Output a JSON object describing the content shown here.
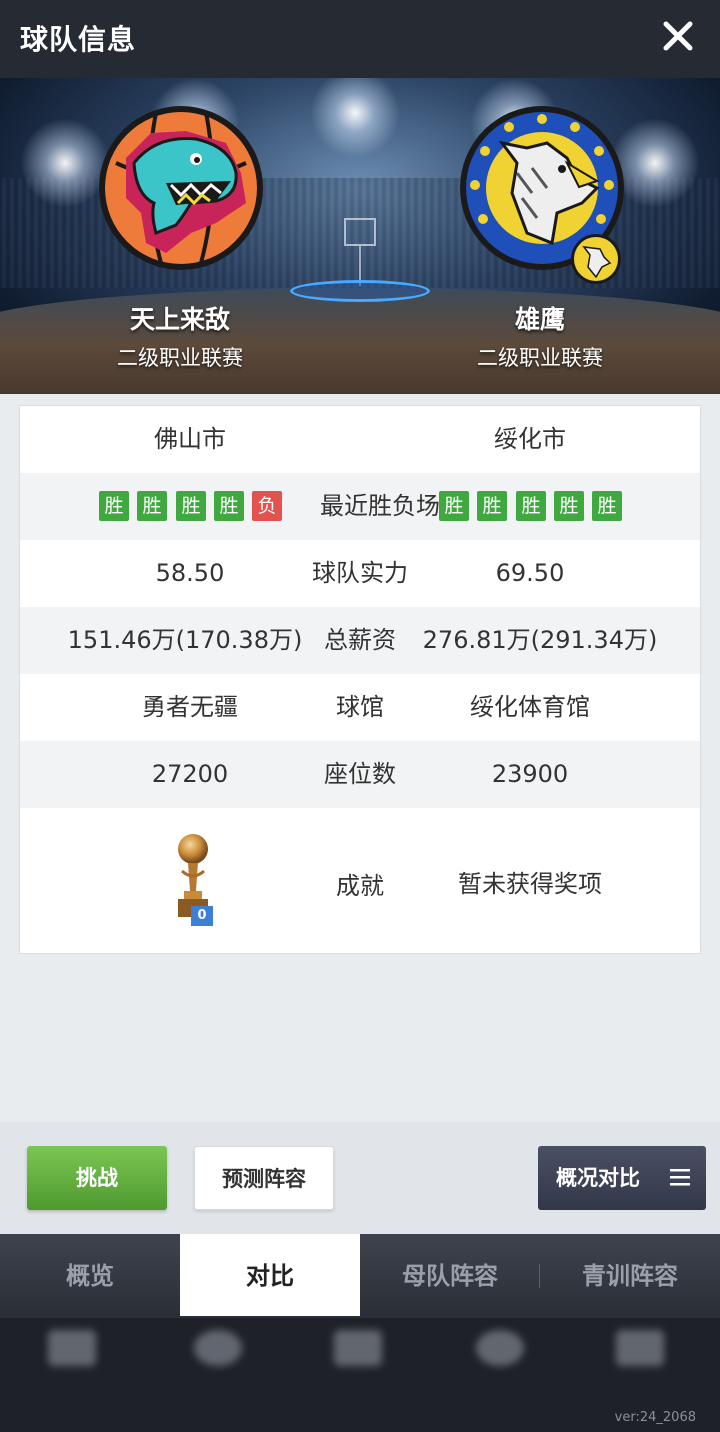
{
  "header": {
    "title": "球队信息"
  },
  "teams": {
    "home": {
      "name": "天上来敌",
      "league": "二级职业联赛",
      "city": "佛山市"
    },
    "away": {
      "name": "雄鹰",
      "league": "二级职业联赛",
      "city": "绥化市"
    }
  },
  "recent": {
    "label": "最近胜负场",
    "home": [
      "胜",
      "胜",
      "胜",
      "胜",
      "负"
    ],
    "away": [
      "胜",
      "胜",
      "胜",
      "胜",
      "胜"
    ]
  },
  "stats": {
    "strength": {
      "label": "球队实力",
      "home": "58.50",
      "away": "69.50"
    },
    "salary": {
      "label": "总薪资",
      "home": "151.46万(170.38万)",
      "away": "276.81万(291.34万)"
    },
    "arena": {
      "label": "球馆",
      "home": "勇者无疆",
      "away": "绥化体育馆"
    },
    "seats": {
      "label": "座位数",
      "home": "27200",
      "away": "23900"
    },
    "achievement": {
      "label": "成就",
      "home_count": "0",
      "away": "暂未获得奖项"
    }
  },
  "actions": {
    "challenge": "挑战",
    "predict": "预测阵容",
    "overview": "概况对比"
  },
  "tabs": [
    {
      "label": "概览",
      "active": false
    },
    {
      "label": "对比",
      "active": true
    },
    {
      "label": "母队阵容",
      "active": false
    },
    {
      "label": "青训阵容",
      "active": false
    }
  ],
  "footer": {
    "version": "ver:24_2068"
  },
  "colors": {
    "win": "#3fa83f",
    "loss": "#e2524f",
    "header": "#262a33",
    "accent_green": "#4d9a2f"
  }
}
